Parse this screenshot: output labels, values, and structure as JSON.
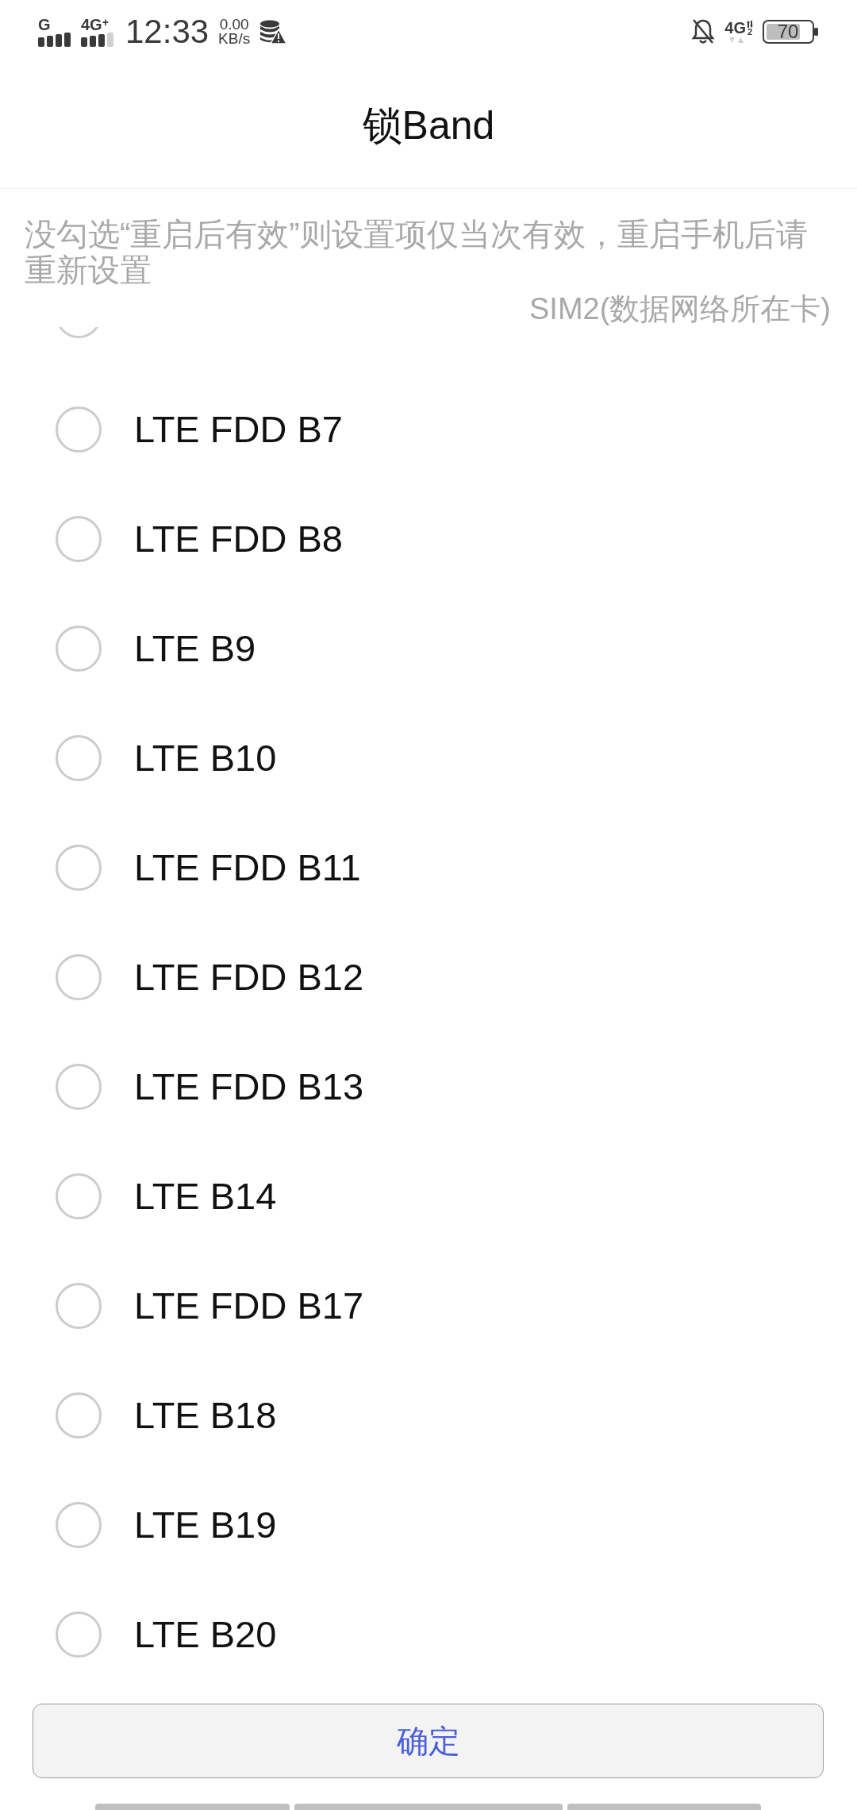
{
  "status_bar": {
    "sim1_network": "G",
    "sim2_network": "4G$^{+}$",
    "time": "12:33",
    "speed": "0.00",
    "speed_unit": "KB/s",
    "data_network": "4G",
    "data_sim": "2",
    "battery": "70"
  },
  "title": "锁Band",
  "notice": "没勾选“重启后有效”则设置项仅当次有效，重启手机后请重新设置",
  "sim_label": "SIM2(数据网络所在卡)",
  "partial_band": {
    "selected": false
  },
  "bands": [
    {
      "label": "LTE FDD B7",
      "selected": false
    },
    {
      "label": "LTE FDD B8",
      "selected": false
    },
    {
      "label": "LTE B9",
      "selected": false
    },
    {
      "label": "LTE B10",
      "selected": false
    },
    {
      "label": "LTE FDD B11",
      "selected": false
    },
    {
      "label": "LTE FDD B12",
      "selected": false
    },
    {
      "label": "LTE FDD B13",
      "selected": false
    },
    {
      "label": "LTE B14",
      "selected": false
    },
    {
      "label": "LTE FDD B17",
      "selected": false
    },
    {
      "label": "LTE B18",
      "selected": false
    },
    {
      "label": "LTE B19",
      "selected": false
    },
    {
      "label": "LTE B20",
      "selected": false
    }
  ],
  "confirm_button": "确定"
}
